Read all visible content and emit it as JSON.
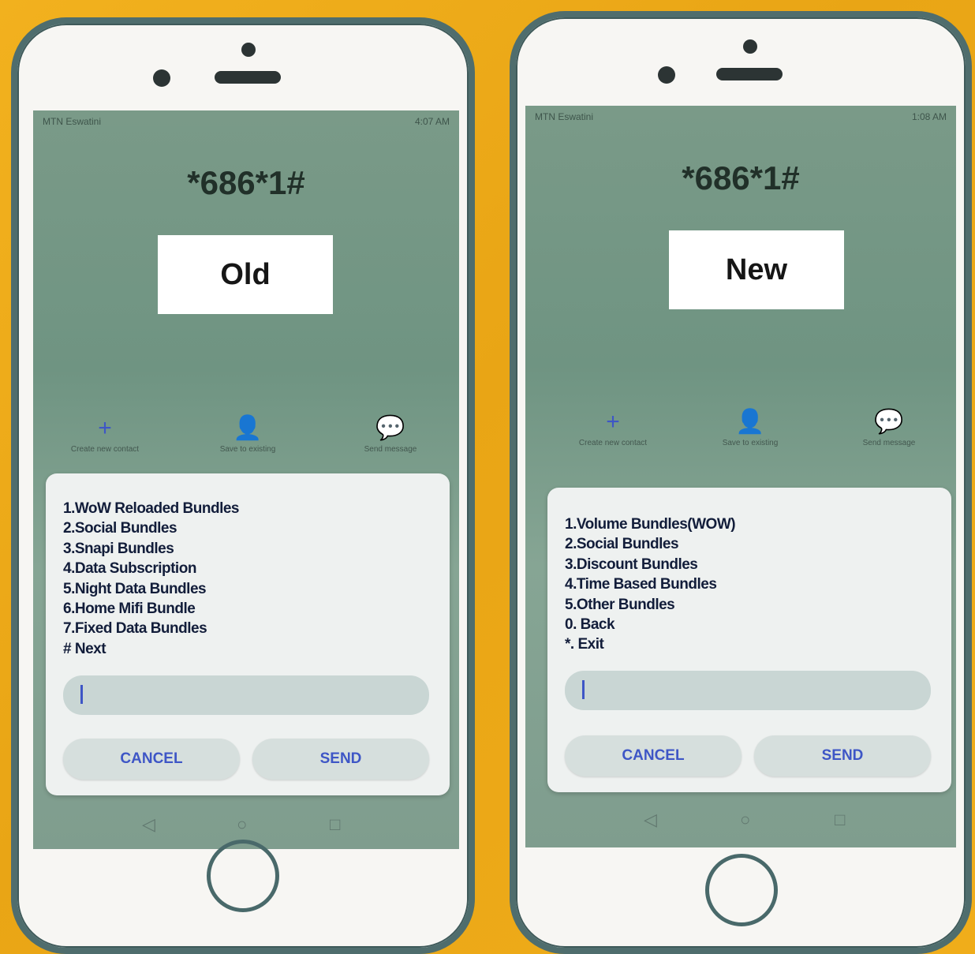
{
  "phones": [
    {
      "ussd_code": "*686*1#",
      "label": "Old",
      "status_left": "MTN Eswatini",
      "status_right": "4:07 AM",
      "actions": [
        {
          "icon": "plus-icon",
          "glyph": "+",
          "label": "Create new contact"
        },
        {
          "icon": "person-icon",
          "glyph": "👤",
          "label": "Save to existing"
        },
        {
          "icon": "message-icon",
          "glyph": "💬",
          "label": "Send message"
        }
      ],
      "menu": [
        "1.WoW Reloaded Bundles",
        "2.Social Bundles",
        "3.Snapi Bundles",
        "4.Data Subscription",
        "5.Night Data Bundles",
        "6.Home Mifi Bundle",
        "7.Fixed Data Bundles",
        "# Next"
      ],
      "input_value": "",
      "cancel_label": "CANCEL",
      "send_label": "SEND"
    },
    {
      "ussd_code": "*686*1#",
      "label": "New",
      "status_left": "MTN Eswatini",
      "status_right": "1:08 AM",
      "actions": [
        {
          "icon": "plus-icon",
          "glyph": "+",
          "label": "Create new contact"
        },
        {
          "icon": "person-icon",
          "glyph": "👤",
          "label": "Save to existing"
        },
        {
          "icon": "message-icon",
          "glyph": "💬",
          "label": "Send message"
        }
      ],
      "menu": [
        "1.Volume Bundles(WOW)",
        "2.Social Bundles",
        "3.Discount Bundles",
        "4.Time Based Bundles",
        "5.Other Bundles",
        "0.  Back",
        "*.  Exit"
      ],
      "input_value": "",
      "cancel_label": "CANCEL",
      "send_label": "SEND"
    }
  ],
  "colors": {
    "background": "#f0ad1a",
    "phone_border": "#4f6d6d",
    "screen": "#7a9a88",
    "accent_blue": "#3e56c6"
  }
}
